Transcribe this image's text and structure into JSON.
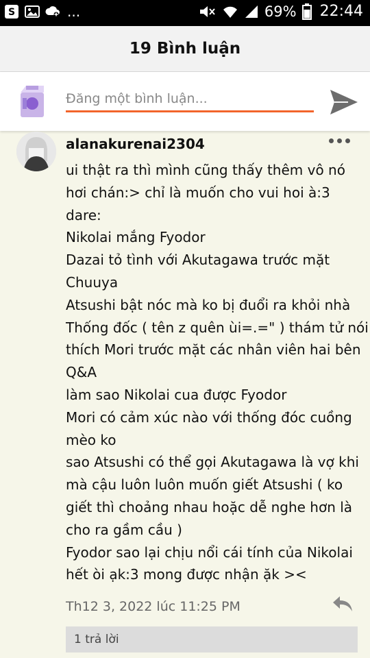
{
  "status_bar": {
    "notification_icons": [
      "skype-icon",
      "image-icon",
      "cloud-icon"
    ],
    "more_indicator": "...",
    "battery_percent": "69%",
    "time": "22:44"
  },
  "header": {
    "title": "19 Bình luận"
  },
  "composer": {
    "placeholder": "Đăng một bình luận..."
  },
  "comment": {
    "username": "alanakurenai2304",
    "lines": [
      "ui thật ra thì mình cũng thấy thêm vô nó",
      "hơi chán:> chỉ là muốn cho vui hoi à:3",
      "dare:",
      "Nikolai mắng Fyodor",
      "Dazai tỏ tình với Akutagawa trước mặt",
      "Chuuya",
      "Atsushi bật nóc mà ko bị đuổi ra khỏi nhà",
      "Thống đốc ( tên z quên ùi=.=\" ) thám tử nói",
      "thích Mori trước mặt các nhân viên hai bên",
      "Q&A",
      "làm sao Nikolai cua được Fyodor",
      "Mori có cảm xúc nào với thống đóc cuồng",
      "mèo ko",
      "sao Atsushi có thể gọi Akutagawa là vợ khi",
      "mà cậu luôn luôn muốn giết Atsushi ( ko",
      "giết thì choảng nhau hoặc dễ nghe hơn là",
      "cho ra gầm cầu )",
      "Fyodor sao lại chịu nổi cái tính của Nikolai",
      "hết òi ạk:3 mong được nhận ặk ><"
    ],
    "timestamp": "Th12 3, 2022 lúc 11:25 PM",
    "replies": "1 trả lời"
  },
  "colors": {
    "accent": "#f2642b",
    "background": "#f6f6e9"
  }
}
